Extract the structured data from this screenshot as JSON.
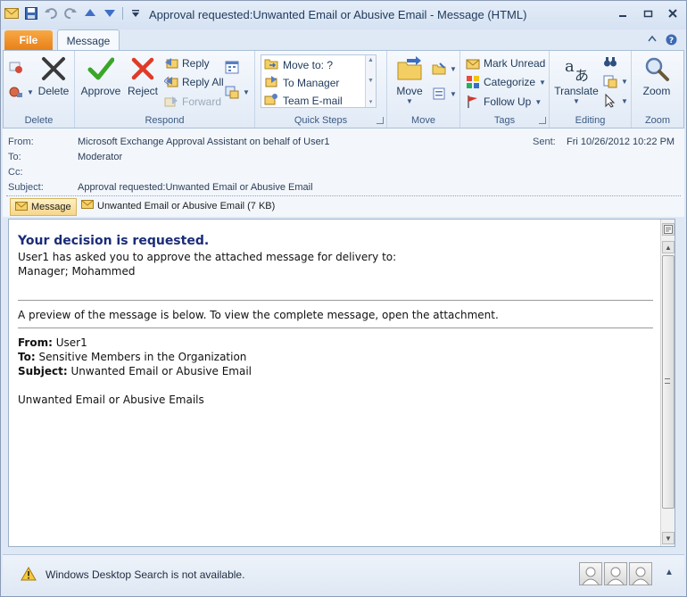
{
  "window": {
    "title": "Approval requested:Unwanted Email or Abusive Email  -  Message (HTML)"
  },
  "tabs": {
    "file": "File",
    "message": "Message"
  },
  "ribbon": {
    "delete_group": {
      "label": "Delete",
      "delete_btn": "Delete"
    },
    "respond_group": {
      "label": "Respond",
      "approve": "Approve",
      "reject": "Reject",
      "reply": "Reply",
      "reply_all": "Reply All",
      "forward": "Forward"
    },
    "quick_steps": {
      "label": "Quick Steps",
      "items": [
        "Move to: ?",
        "To Manager",
        "Team E-mail"
      ]
    },
    "move_group": {
      "label": "Move",
      "move_btn": "Move"
    },
    "tags_group": {
      "label": "Tags",
      "mark_unread": "Mark Unread",
      "categorize": "Categorize",
      "follow_up": "Follow Up"
    },
    "editing_group": {
      "label": "Editing",
      "translate": "Translate"
    },
    "zoom_group": {
      "label": "Zoom",
      "zoom_btn": "Zoom"
    }
  },
  "header": {
    "from_label": "From:",
    "from_value": "Microsoft Exchange Approval Assistant on behalf of User1",
    "to_label": "To:",
    "to_value": "Moderator",
    "cc_label": "Cc:",
    "cc_value": "",
    "subject_label": "Subject:",
    "subject_value": "Approval requested:Unwanted Email or Abusive Email",
    "sent_label": "Sent:",
    "sent_value": "Fri 10/26/2012 10:22 PM"
  },
  "attachments": {
    "message_tab": "Message",
    "file": "Unwanted Email or Abusive Email (7 KB)"
  },
  "body": {
    "heading": "Your decision is requested.",
    "line1": "User1 has asked you to approve the attached message for delivery to:",
    "line2": "Manager; Mohammed",
    "preview_note": "A preview of the message is below. To view the complete message, open the attachment.",
    "from_label": "From:",
    "from_value": "User1",
    "to_label": "To:",
    "to_value": "Sensitive Members in the Organization",
    "subject_label": "Subject:",
    "subject_value": "Unwanted Email or Abusive Email",
    "message_text": "Unwanted Email or Abusive Emails"
  },
  "status": {
    "text": "Windows Desktop Search is not available."
  }
}
